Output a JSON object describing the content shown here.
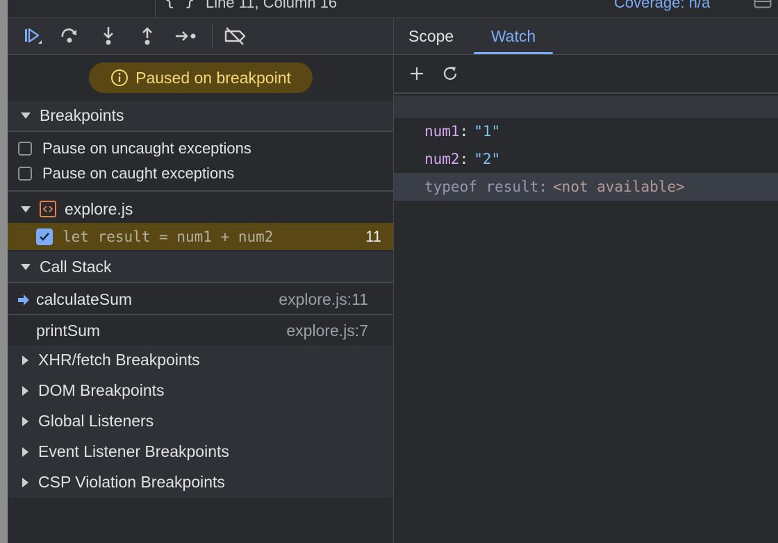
{
  "status_bar": {
    "braces_label": "{ }",
    "position_text": "Line 11, Column 16",
    "coverage_text": "Coverage: n/a"
  },
  "debugger": {
    "paused_message": "Paused on breakpoint",
    "sections": {
      "breakpoints": "Breakpoints",
      "call_stack": "Call Stack",
      "xhr": "XHR/fetch Breakpoints",
      "dom": "DOM Breakpoints",
      "global": "Global Listeners",
      "event": "Event Listener Breakpoints",
      "csp": "CSP Violation Breakpoints"
    },
    "pause_options": [
      {
        "label": "Pause on uncaught exceptions",
        "checked": false
      },
      {
        "label": "Pause on caught exceptions",
        "checked": false
      }
    ],
    "breakpoint_file": "explore.js",
    "breakpoint": {
      "code": "let result = num1 + num2",
      "line": "11",
      "checked": true
    },
    "call_stack": [
      {
        "function": "calculateSum",
        "location": "explore.js:11",
        "current": true
      },
      {
        "function": "printSum",
        "location": "explore.js:7",
        "current": false
      }
    ]
  },
  "sidebar_tabs": {
    "scope": "Scope",
    "watch": "Watch",
    "active": "Watch"
  },
  "watch": {
    "expressions": [
      {
        "name": "num1",
        "value": "\"1\""
      },
      {
        "name": "num2",
        "value": "\"2\""
      },
      {
        "name": "typeof result",
        "value": "<not available>"
      }
    ]
  },
  "colors": {
    "accent": "#7cacf8",
    "paused_bg": "#5a4814",
    "paused_text": "#f4d87a",
    "watch_name": "#d6a8f5",
    "watch_value": "#7cc8f0"
  }
}
